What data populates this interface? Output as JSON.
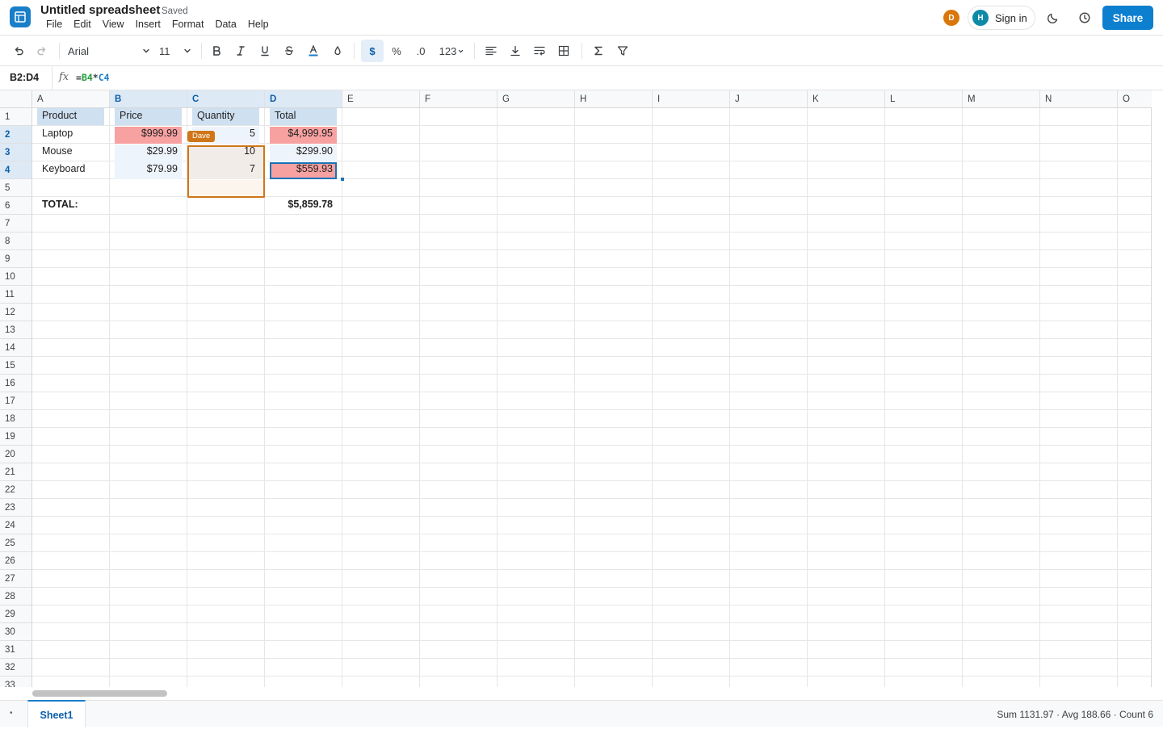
{
  "header": {
    "title": "Untitled spreadsheet",
    "save_status": "Saved",
    "menu": [
      "File",
      "Edit",
      "View",
      "Insert",
      "Format",
      "Data",
      "Help"
    ],
    "collaborator_initial": "D",
    "collaborator_color": "#d9770a",
    "user_initial": "H",
    "signin_label": "Sign in",
    "share_label": "Share",
    "accent_color": "#0d7fcf"
  },
  "toolbar": {
    "font_family": "Arial",
    "font_size": "11",
    "percent_label": "%",
    "decimal_label": ".0",
    "number_format_label": "123",
    "currency_label": "$"
  },
  "formula_bar": {
    "name_box": "B2:D4",
    "fx_label": "fx",
    "eq": "=",
    "ref1": "B4",
    "op": "*",
    "ref2": "C4"
  },
  "grid": {
    "columns": [
      "A",
      "B",
      "C",
      "D",
      "E",
      "F",
      "G",
      "H",
      "I",
      "J",
      "K",
      "L",
      "M",
      "N",
      "O"
    ],
    "selected_columns": [
      "B",
      "C",
      "D"
    ],
    "rows": [
      1,
      2,
      3,
      4,
      5,
      6,
      7,
      8,
      9,
      10,
      11,
      12,
      13,
      14,
      15,
      16,
      17,
      18,
      19,
      20,
      21,
      22,
      23,
      24,
      25,
      26,
      27,
      28,
      29,
      30,
      31,
      32,
      33
    ],
    "selected_rows": [
      2,
      3,
      4
    ],
    "cells": {
      "A1": "Product",
      "B1": "Price",
      "C1": "Quantity",
      "D1": "Total",
      "A2": "Laptop",
      "B2": "$999.99",
      "C2": "5",
      "D2": "$4,999.95",
      "A3": "Mouse",
      "B3": "$29.99",
      "C3": "10",
      "D3": "$299.90",
      "A4": "Keyboard",
      "B4": "$79.99",
      "C4": "7",
      "D4": "$559.93",
      "A6": "TOTAL:",
      "D6": "$5,859.78"
    },
    "collaborator_cursor_label": "Dave",
    "collaborator_cursor_color": "#cf7617"
  },
  "footer": {
    "sheet_tabs": [
      "Sheet1"
    ],
    "stats": "Sum 1131.97 · Avg 188.66 · Count 6"
  }
}
